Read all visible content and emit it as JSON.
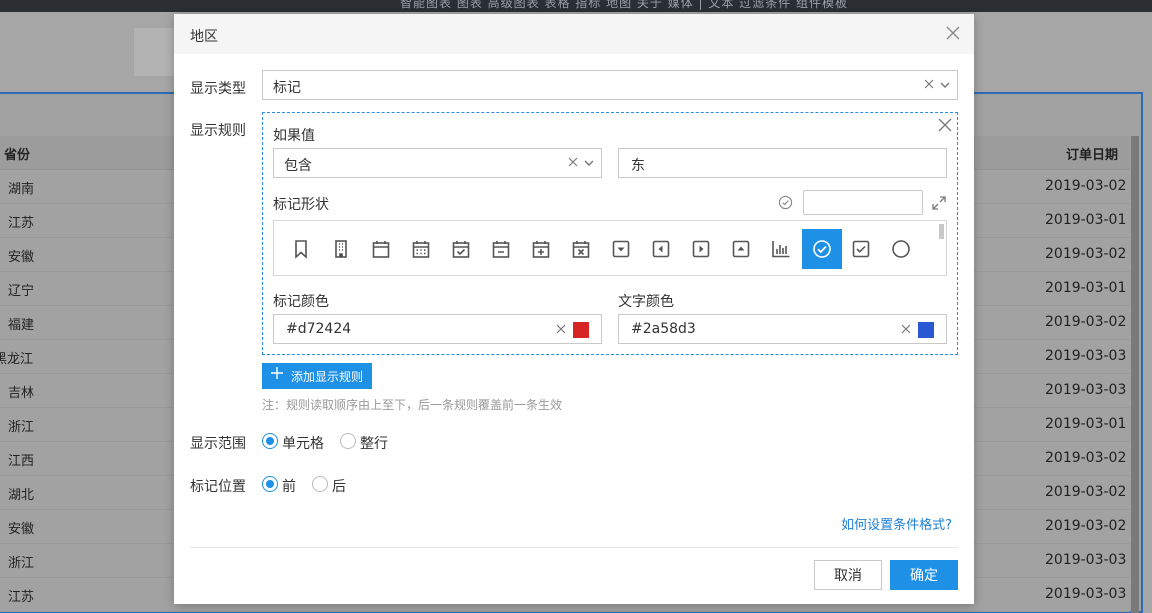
{
  "background": {
    "menu_text": "智能图表   图表   高级图表   表格   指标   地图   关于   媒体   |   文本   过滤条件   组件模板",
    "left_header": "省份",
    "right_header": "订单日期",
    "rows": [
      {
        "province": "湖南",
        "date": "2019-03-02"
      },
      {
        "province": "江苏",
        "date": "2019-03-01"
      },
      {
        "province": "安徽",
        "date": "2019-03-02"
      },
      {
        "province": "辽宁",
        "date": "2019-03-01"
      },
      {
        "province": "福建",
        "date": "2019-03-02"
      },
      {
        "province": "黑龙江",
        "date": "2019-03-03"
      },
      {
        "province": "吉林",
        "date": "2019-03-03"
      },
      {
        "province": "浙江",
        "date": "2019-03-01"
      },
      {
        "province": "江西",
        "date": "2019-03-02"
      },
      {
        "province": "湖北",
        "date": "2019-03-02"
      },
      {
        "province": "安徽",
        "date": "2019-03-02"
      },
      {
        "province": "浙江",
        "date": "2019-03-03"
      },
      {
        "province": "江苏",
        "date": "2019-03-03"
      }
    ]
  },
  "dialog": {
    "title": "地区",
    "display_type_label": "显示类型",
    "display_type_value": "标记",
    "display_rule_label": "显示规则",
    "rule": {
      "condition_label": "如果值",
      "operator_value": "包含",
      "compare_value": "东",
      "shape_label": "标记形状",
      "shape_search_value": "",
      "shapes": [
        "bookmark-icon",
        "building-icon",
        "calendar-icon",
        "calendar-grid-icon",
        "calendar-check-icon",
        "calendar-minus-icon",
        "calendar-plus-icon",
        "calendar-x-icon",
        "caret-square-down-icon",
        "caret-square-left-icon",
        "caret-square-right-icon",
        "caret-square-up-icon",
        "bar-chart-icon",
        "check-circle-icon",
        "check-square-icon",
        "circle-icon"
      ],
      "selected_shape": "check-circle-icon",
      "mark_color_label": "标记颜色",
      "mark_color_value": "#d72424",
      "text_color_label": "文字颜色",
      "text_color_value": "#2a58d3"
    },
    "add_rule_label": "添加显示规则",
    "note": "注：规则读取顺序由上至下，后一条规则覆盖前一条生效",
    "range_label": "显示范围",
    "range_option_cell": "单元格",
    "range_option_row": "整行",
    "position_label": "标记位置",
    "position_option_before": "前",
    "position_option_after": "后",
    "help_link": "如何设置条件格式?",
    "cancel_label": "取消",
    "ok_label": "确定"
  }
}
